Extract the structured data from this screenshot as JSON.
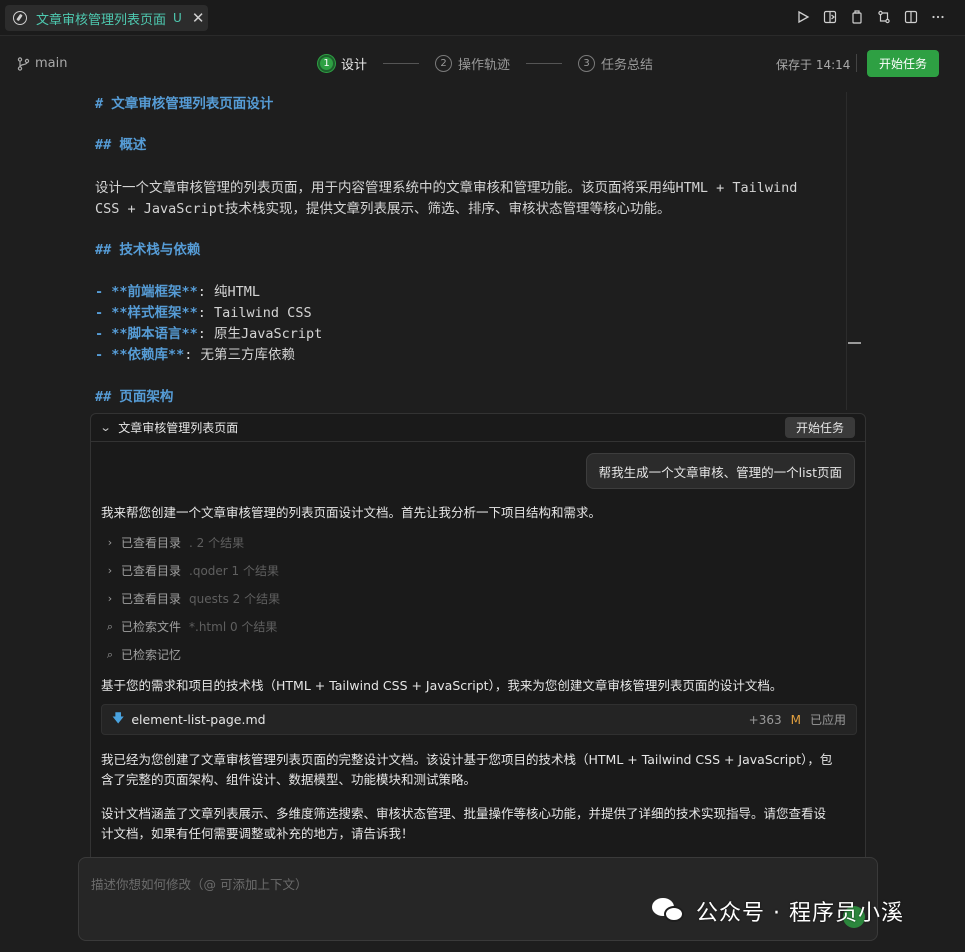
{
  "tab": {
    "title": "文章审核管理列表页面",
    "badge": "U",
    "close": "✕"
  },
  "toolbar": {
    "branch": "main",
    "steps": [
      {
        "num": "1",
        "label": "设计"
      },
      {
        "num": "2",
        "label": "操作轨迹"
      },
      {
        "num": "3",
        "label": "任务总结"
      }
    ],
    "saved": "保存于 14:14",
    "start_label": "开始任务"
  },
  "doc": {
    "h1": "# 文章审核管理列表页面设计",
    "h2_overview": "## 概述",
    "overview_1": "设计一个文章审核管理的列表页面，用于内容管理系统中的文章审核和管理功能。该页面将采用纯HTML + Tailwind",
    "overview_2": "CSS + JavaScript技术栈实现，提供文章列表展示、筛选、排序、审核状态管理等核心功能。",
    "h2_stack": "## 技术栈与依赖",
    "stack": [
      {
        "key": "- **前端框架**",
        "val": ": 纯HTML"
      },
      {
        "key": "- **样式框架**",
        "val": ": Tailwind CSS"
      },
      {
        "key": "- **脚本语言**",
        "val": ": 原生JavaScript"
      },
      {
        "key": "- **依赖库**",
        "val": ": 无第三方库依赖"
      }
    ],
    "h2_arch": "## 页面架构"
  },
  "panel": {
    "title": "文章审核管理列表页面",
    "start_label": "开始任务",
    "user_msg": "帮我生成一个文章审核、管理的一个list页面",
    "intro": "我来帮您创建一个文章审核管理的列表页面设计文档。首先让我分析一下项目结构和需求。",
    "tools": [
      {
        "icon": "›",
        "label": "已查看目录",
        "detail": ". 2 个结果"
      },
      {
        "icon": "›",
        "label": "已查看目录",
        "detail": ".qoder 1 个结果"
      },
      {
        "icon": "›",
        "label": "已查看目录",
        "detail": "quests 2 个结果"
      },
      {
        "icon": "⌕",
        "label": "已检索文件",
        "detail": "*.html 0 个结果"
      },
      {
        "icon": "⌕",
        "label": "已检索记忆",
        "detail": ""
      }
    ],
    "basis": "基于您的需求和项目的技术栈（HTML + Tailwind CSS + JavaScript），我来为您创建文章审核管理列表页面的设计文档。",
    "file": {
      "name": "element-list-page.md",
      "additions": "+363",
      "status_letter": "M",
      "status": "已应用"
    },
    "summary_1a": "我已经为您创建了文章审核管理列表页面的完整设计文档。该设计基于您项目的技术栈（HTML + Tailwind CSS + JavaScript），包",
    "summary_1b": "含了完整的页面架构、组件设计、数据模型、功能模块和测试策略。",
    "summary_2a": "设计文档涵盖了文章列表展示、多维度筛选搜索、审核状态管理、批量操作等核心功能，并提供了详细的技术实现指导。请您查看设",
    "summary_2b": "计文档，如果有任何需要调整或补充的地方，请告诉我！"
  },
  "input": {
    "placeholder": "描述你想如何修改（@ 可添加上下文）"
  },
  "watermark": {
    "text": "公众号 · 程序员小溪"
  }
}
